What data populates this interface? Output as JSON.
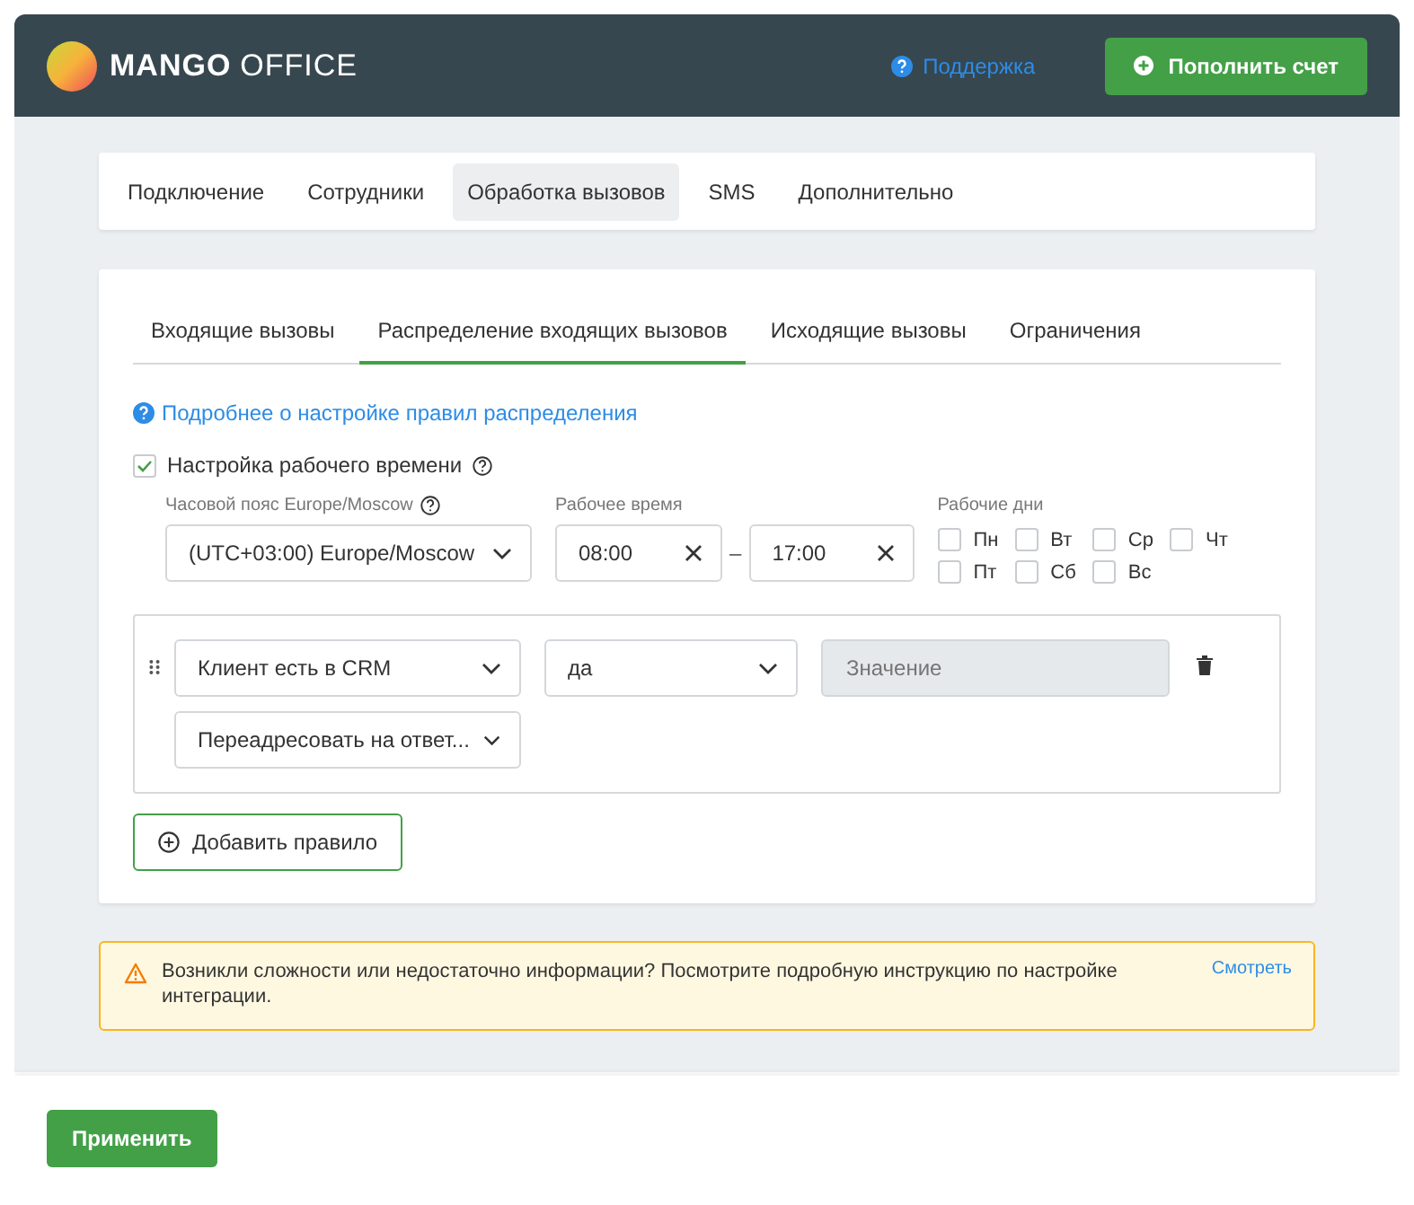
{
  "header": {
    "logo_bold": "MANGO",
    "logo_light": "OFFICE",
    "support_link": "Поддержка",
    "topup_button": "Пополнить счет"
  },
  "nav_tabs": [
    {
      "label": "Подключение",
      "selected": false
    },
    {
      "label": "Сотрудники",
      "selected": false
    },
    {
      "label": "Обработка вызовов",
      "selected": true
    },
    {
      "label": "SMS",
      "selected": false
    },
    {
      "label": "Дополнительно",
      "selected": false
    }
  ],
  "sub_tabs": [
    {
      "label": "Входящие вызовы",
      "selected": false
    },
    {
      "label": "Распределение входящих вызовов",
      "selected": true
    },
    {
      "label": "Исходящие вызовы",
      "selected": false
    },
    {
      "label": "Ограничения",
      "selected": false
    }
  ],
  "help_link": "Подробнее о настройке правил распределения",
  "work_time": {
    "label": "Настройка рабочего времени",
    "checked": true,
    "timezone_label": "Часовой пояс Europe/Moscow",
    "timezone": "(UTC+03:00) Europe/Moscow",
    "hours_label": "Рабочее время",
    "from": "08:00",
    "separator": "–",
    "to": "17:00",
    "days_label": "Рабочие дни",
    "days": [
      {
        "label": "Пн",
        "checked": false
      },
      {
        "label": "Вт",
        "checked": false
      },
      {
        "label": "Ср",
        "checked": false
      },
      {
        "label": "Чт",
        "checked": false
      },
      {
        "label": "Пт",
        "checked": false
      },
      {
        "label": "Сб",
        "checked": false
      },
      {
        "label": "Вс",
        "checked": false
      }
    ]
  },
  "rule": {
    "condition": "Клиент есть в CRM",
    "operator": "да",
    "value_placeholder": "Значение",
    "action": "Переадресовать на ответ..."
  },
  "add_rule_button": "Добавить правило",
  "notice": {
    "text": "Возникли сложности или недостаточно информации? Посмотрите подробную инструкцию по настройке интеграции.",
    "link": "Смотреть"
  },
  "apply_button": "Применить"
}
